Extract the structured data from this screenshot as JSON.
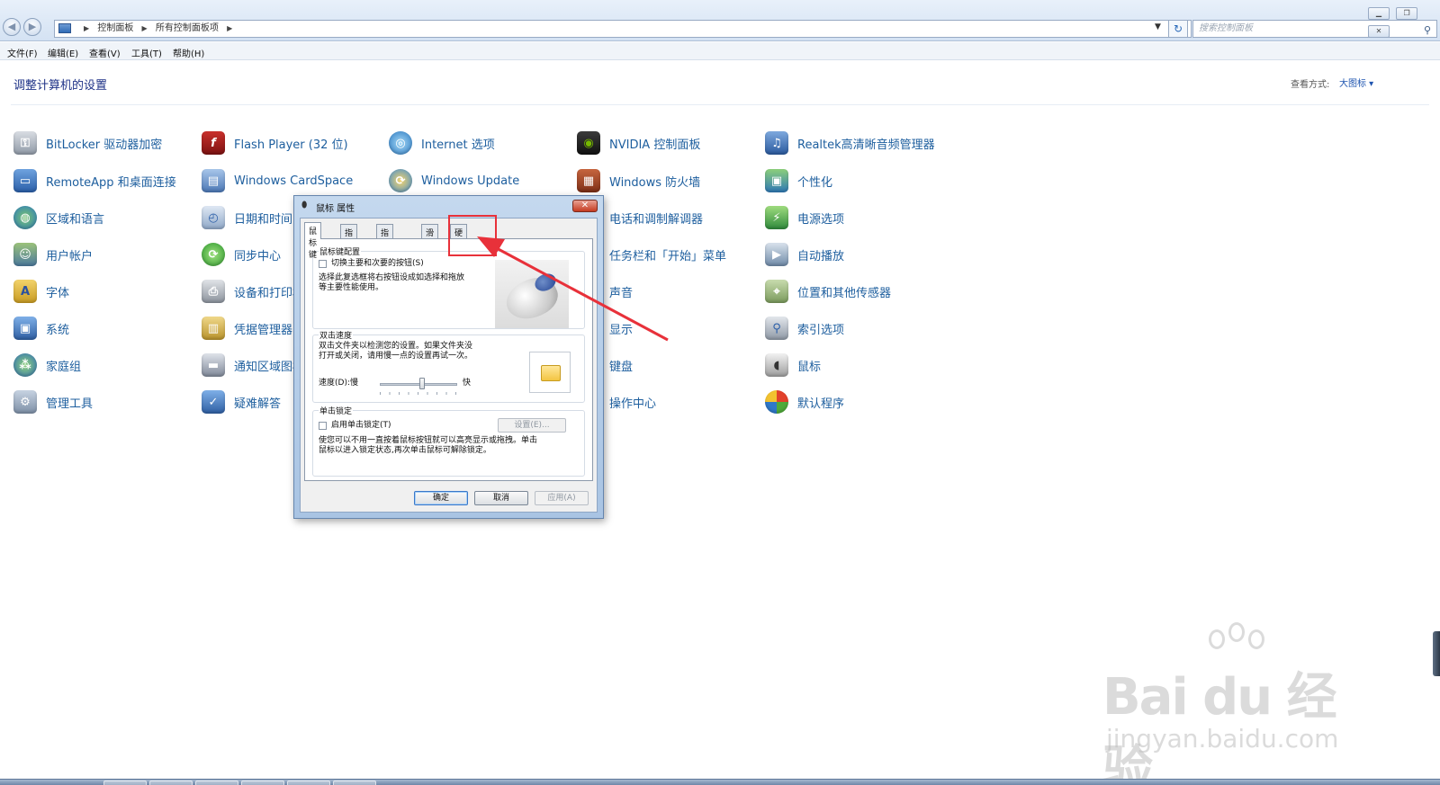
{
  "window": {
    "breadcrumb": [
      "控制面板",
      "所有控制面板项"
    ],
    "search_placeholder": "搜索控制面板"
  },
  "menu": [
    "文件(F)",
    "编辑(E)",
    "查看(V)",
    "工具(T)",
    "帮助(H)"
  ],
  "header": {
    "title": "调整计算机的设置",
    "view_label": "查看方式:",
    "view_value": "大图标 ▾"
  },
  "items": {
    "c1": [
      "BitLocker 驱动器加密",
      "RemoteApp 和桌面连接",
      "区域和语言",
      "用户帐户",
      "字体",
      "系统",
      "家庭组",
      "管理工具"
    ],
    "c2": [
      "Flash Player (32 位)",
      "Windows CardSpace",
      "日期和时间",
      "同步中心",
      "设备和打印机",
      "凭据管理器",
      "通知区域图标",
      "疑难解答"
    ],
    "c3": [
      "Internet 选项",
      "Windows Update"
    ],
    "c4": [
      "NVIDIA 控制面板",
      "Windows 防火墙",
      "电话和调制解调器",
      "任务栏和「开始」菜单",
      "声音",
      "显示",
      "键盘",
      "操作中心"
    ],
    "c5": [
      "Realtek高清晰音频管理器",
      "个性化",
      "电源选项",
      "自动播放",
      "位置和其他传感器",
      "索引选项",
      "鼠标",
      "默认程序"
    ]
  },
  "dialog": {
    "title": "鼠标 属性",
    "tabs": [
      "鼠标键",
      "指针",
      "指针选项",
      "滑轮",
      "硬件"
    ],
    "button_config": {
      "title": "鼠标键配置",
      "checkbox": "切换主要和次要的按钮(S)",
      "desc1": "选择此复选框将右按钮设成如选择和拖放",
      "desc2": "等主要性能使用。"
    },
    "double_click": {
      "title": "双击速度",
      "desc1": "双击文件夹以检测您的设置。如果文件夹没",
      "desc2": "打开或关闭，请用慢一点的设置再试一次。",
      "speed_label": "速度(D):慢",
      "fast_label": "快",
      "speed_level": 0.55
    },
    "click_lock": {
      "title": "单击锁定",
      "checkbox": "启用单击锁定(T)",
      "settings_button": "设置(E)...",
      "desc1": "使您可以不用一直按着鼠标按钮就可以高亮显示或拖拽。单击",
      "desc2": "鼠标以进入锁定状态,再次单击鼠标可解除锁定。"
    },
    "ok": "确定",
    "cancel": "取消",
    "apply": "应用(A)"
  },
  "watermark": {
    "main": "Bai du 经验",
    "sub": "jingyan.baidu.com"
  },
  "colors": {
    "item_text": "#1d5e9e",
    "title_text": "#1e3287",
    "annotation": "#e8313a"
  }
}
